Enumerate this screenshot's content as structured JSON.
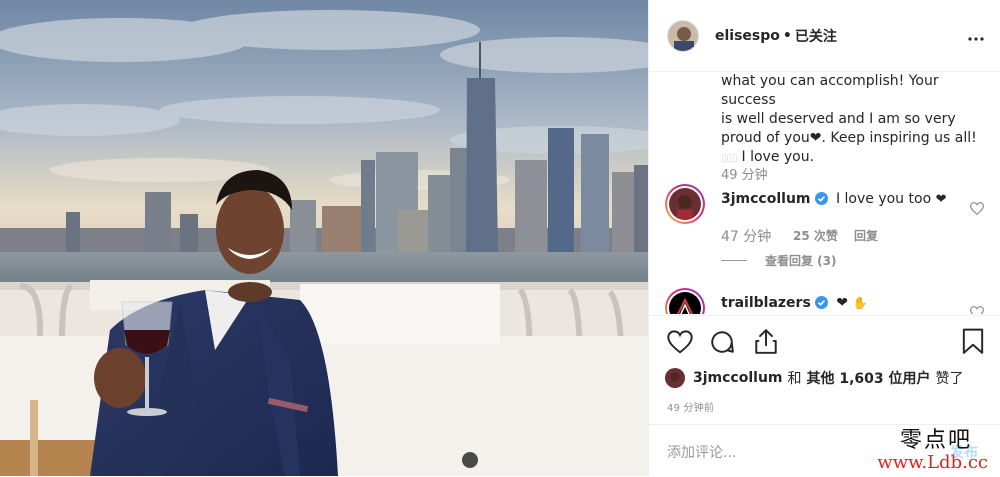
{
  "header": {
    "username": "elisespo",
    "separator": "•",
    "follow": "已关注",
    "more_icon": "more-horizontal-icon"
  },
  "caption": {
    "lines": [
      "what you can accomplish! Your success",
      "is well deserved and I am so very",
      "proud of you❤︎. Keep inspiring us all!",
      "I love you."
    ],
    "time": "49 分钟"
  },
  "comments": [
    {
      "username": "3jmccollum",
      "text": "I love you too",
      "time": "47 分钟",
      "likes": "25 次赞",
      "reply": "回复",
      "view_replies": "查看回复 (3)"
    },
    {
      "username": "trailblazers",
      "text": "❤︎"
    }
  ],
  "likes": {
    "user": "3jmccollum",
    "and": "和",
    "others": "其他 1,603 位用户",
    "suffix": "赞了"
  },
  "timestamp": "49 分钟前",
  "add_comment": {
    "placeholder": "添加评论...",
    "publish": "发布"
  },
  "watermark": {
    "line1": "零点吧",
    "line2": "www.Ldb.cc"
  },
  "colors": {
    "verified": "#3897f0",
    "text": "#262626",
    "muted": "#8e8e8e",
    "publish": "#b3dbff",
    "watermark_red": "#e0231b"
  }
}
